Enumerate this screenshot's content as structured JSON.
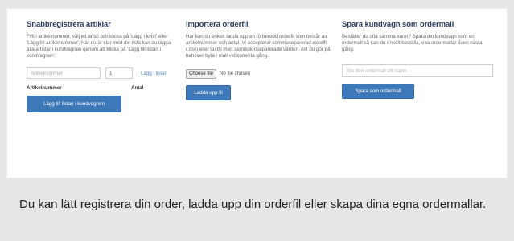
{
  "quick_register": {
    "title": "Snabbregistrera artiklar",
    "description": "Fyll i artikelnummer, välj ett antal och klicka på 'Lägg i kvist' eller 'Lägg till artikelnummer'. När du är klar med din lista kan du lägga alla artiklar i kundvagnen genom att klicka på 'Lägg till listan i kundvagnen'.",
    "article_placeholder": "Artikelnummer",
    "quantity_value": "1",
    "add_link": "Lägg i listan",
    "col_article": "Artikelnummer",
    "col_quantity": "Antal",
    "add_to_cart_button": "Lägg till listan i kundvagnen"
  },
  "import_order": {
    "title": "Importera orderfil",
    "description": "Här kan du enkelt ladda upp en förberedd orderfil som består av artikelnummer och antal. Vi accepterar kommaseparerad excelfil (.csv) eller textfil med semikolonseparerade värden. Allt du gör på behöver byta i mall vid korrekta gång.",
    "choose_file_button": "Choose file",
    "no_file_text": "No file chosen",
    "upload_button": "Ladda upp fil"
  },
  "save_template": {
    "title": "Spara kundvagn som ordermall",
    "description": "Beställer du ofta samma varor? Spara din kundvagn som en ordermall så kan du enkelt beställa, ena ordermallar även nästa gång.",
    "name_placeholder": "Ge den ordermall ett namn",
    "save_button": "Spara som ordermall"
  },
  "caption": "Du kan lätt registrera din order, ladda upp din orderfil eller skapa dina egna ordermallar."
}
